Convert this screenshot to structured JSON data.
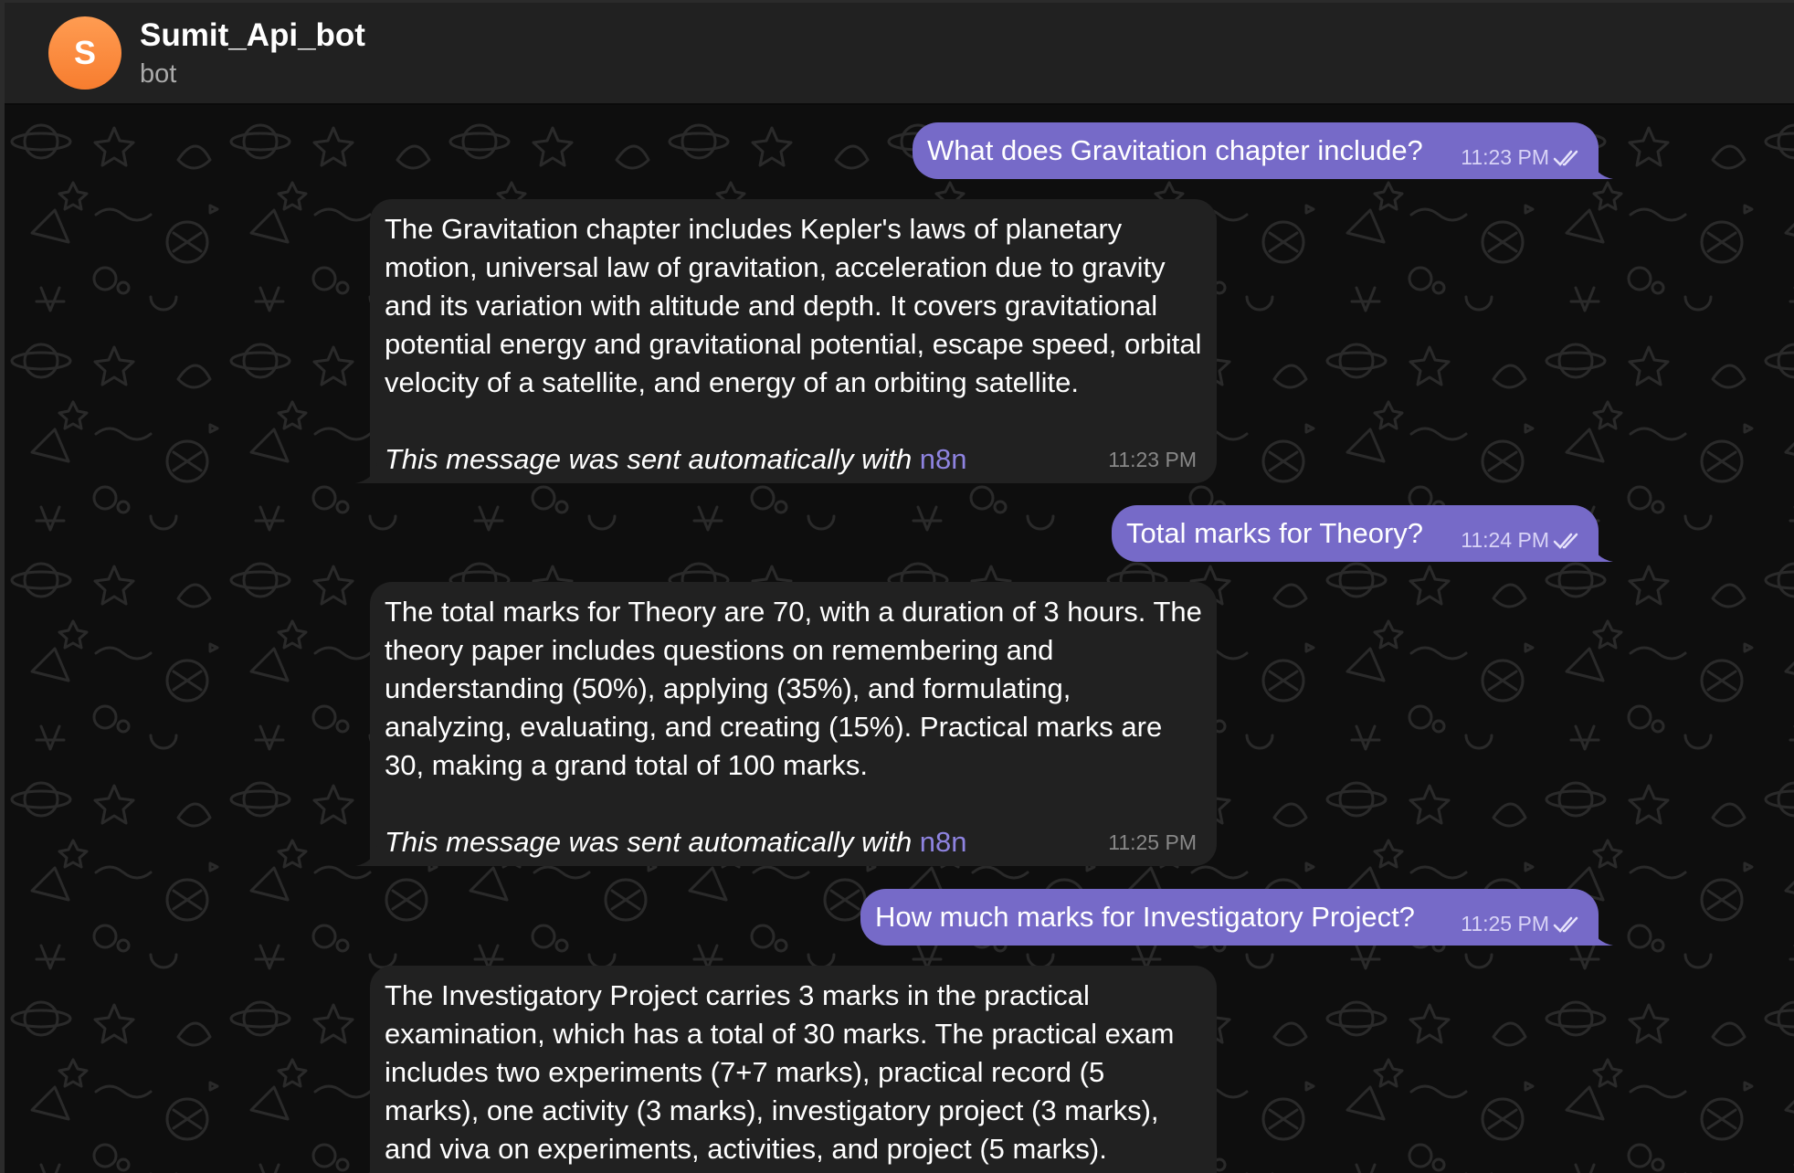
{
  "header": {
    "avatar_letter": "S",
    "title": "Sumit_Api_bot",
    "subtitle": "bot"
  },
  "messages": [
    {
      "type": "outgoing",
      "text": "What does Gravitation chapter include?",
      "time": "11:23 PM",
      "read": true
    },
    {
      "type": "incoming",
      "text": "The Gravitation chapter includes Kepler's laws of planetary motion, universal law of gravitation, acceleration due to gravity and its variation with altitude and depth. It covers gravitational potential energy and gravitational potential, escape speed, orbital velocity of a satellite, and energy of an orbiting satellite.",
      "footer_text": "This message was sent automatically with ",
      "footer_link": "n8n",
      "time": "11:23 PM"
    },
    {
      "type": "outgoing",
      "text": "Total marks for Theory?",
      "time": "11:24 PM",
      "read": true
    },
    {
      "type": "incoming",
      "text": "The total marks for Theory are 70, with a duration of 3 hours. The theory paper includes questions on remembering and understanding (50%), applying (35%), and formulating, analyzing, evaluating, and creating (15%). Practical marks are 30, making a grand total of 100 marks.",
      "footer_text": "This message was sent automatically with ",
      "footer_link": "n8n",
      "time": "11:25 PM"
    },
    {
      "type": "outgoing",
      "text": "How much marks for Investigatory Project?",
      "time": "11:25 PM",
      "read": true
    },
    {
      "type": "incoming",
      "text": "The Investigatory Project carries 3 marks in the practical examination, which has a total of 30 marks. The practical exam includes two experiments (7+7 marks), practical record (5 marks), one activity (3 marks), investigatory project (3 marks), and viva on experiments, activities, and project (5 marks).",
      "footer_text": "",
      "footer_link": "",
      "time": ""
    }
  ],
  "colors": {
    "outgoing_bubble": "#766ac8",
    "incoming_bubble": "#212121",
    "header_bg": "#212121",
    "chat_bg": "#0e0e0e",
    "avatar": "#f77d2f",
    "link": "#8e83e0"
  },
  "icons": {
    "read_receipt": "double-check-icon",
    "background": "doodle-pattern"
  }
}
